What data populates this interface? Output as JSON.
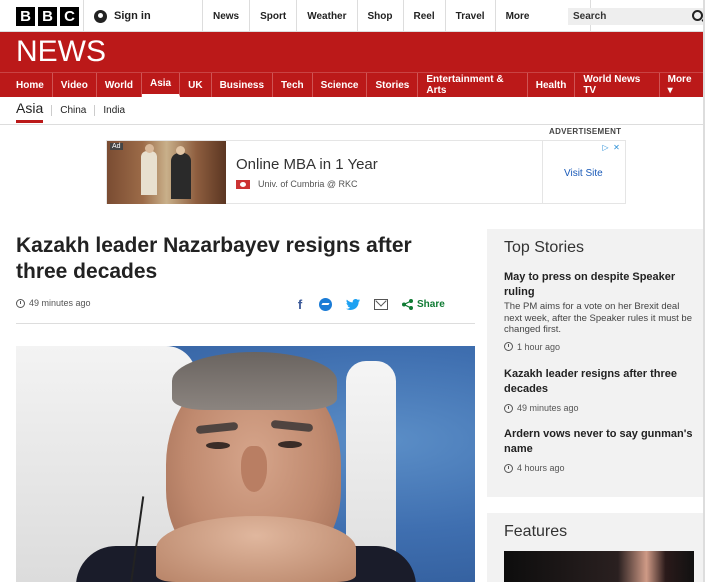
{
  "topbar": {
    "logo_letters": [
      "B",
      "B",
      "C"
    ],
    "sign_in": "Sign in",
    "nav": [
      "News",
      "Sport",
      "Weather",
      "Shop",
      "Reel",
      "Travel"
    ],
    "more": "More",
    "search_placeholder": "Search"
  },
  "banner": {
    "title": "NEWS"
  },
  "main_nav": {
    "items": [
      "Home",
      "Video",
      "World",
      "Asia",
      "UK",
      "Business",
      "Tech",
      "Science",
      "Stories",
      "Entertainment & Arts",
      "Health",
      "World News TV",
      "More ▾"
    ],
    "active": "Asia"
  },
  "sub_nav": {
    "current": "Asia",
    "items": [
      "China",
      "India"
    ]
  },
  "advert": {
    "label": "ADVERTISEMENT",
    "badge": "Ad",
    "title": "Online MBA in 1 Year",
    "sponsor": "Univ. of Cumbria @ RKC",
    "cta": "Visit Site"
  },
  "article": {
    "headline": "Kazakh leader Nazarbayev resigns after three decades",
    "time": "49 minutes ago",
    "share_label": "Share"
  },
  "top_stories": {
    "title": "Top Stories",
    "stories": [
      {
        "title": "May to press on despite Speaker ruling",
        "summary": "The PM aims for a vote on her Brexit deal next week, after the Speaker rules it must be changed first.",
        "time": "1 hour ago"
      },
      {
        "title": "Kazakh leader resigns after three decades",
        "summary": "",
        "time": "49 minutes ago"
      },
      {
        "title": "Ardern vows never to say gunman's name",
        "summary": "",
        "time": "4 hours ago"
      }
    ]
  },
  "features": {
    "title": "Features"
  }
}
